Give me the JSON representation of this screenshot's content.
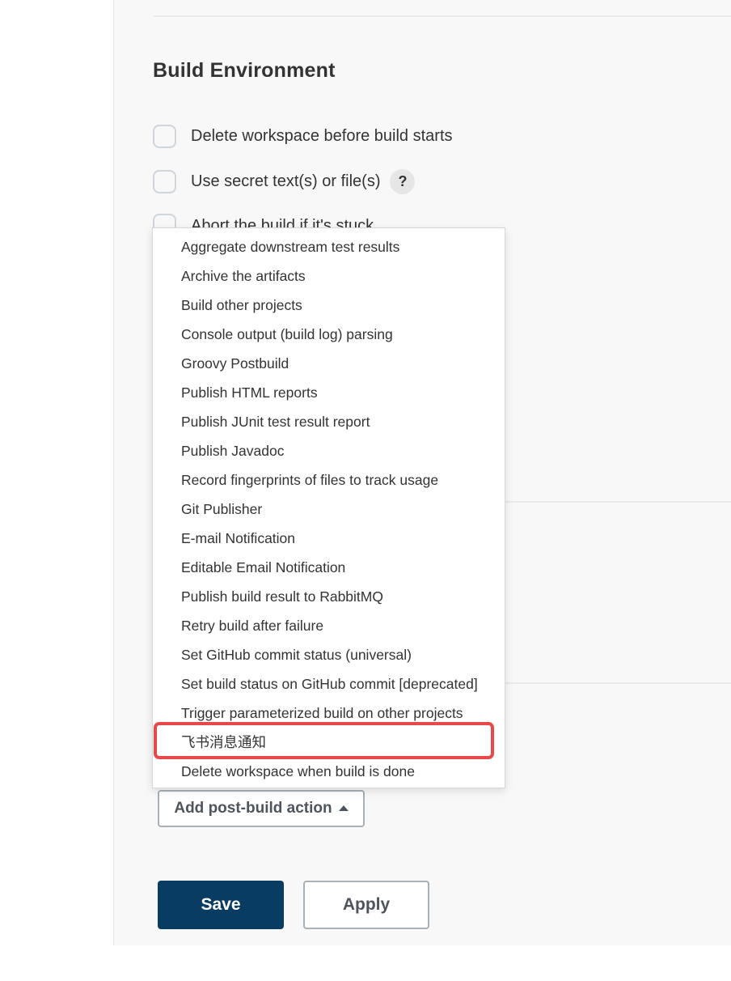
{
  "build_environment": {
    "title": "Build Environment",
    "options": [
      {
        "label": "Delete workspace before build starts",
        "checked": false
      },
      {
        "label": "Use secret text(s) or file(s)",
        "checked": false,
        "help": "?"
      },
      {
        "label": "Abort the build if it's stuck",
        "checked": false
      }
    ]
  },
  "post_build_menu": {
    "items": [
      "Aggregate downstream test results",
      "Archive the artifacts",
      "Build other projects",
      "Console output (build log) parsing",
      "Groovy Postbuild",
      "Publish HTML reports",
      "Publish JUnit test result report",
      "Publish Javadoc",
      "Record fingerprints of files to track usage",
      "Git Publisher",
      "E-mail Notification",
      "Editable Email Notification",
      "Publish build result to RabbitMQ",
      "Retry build after failure",
      "Set GitHub commit status (universal)",
      "Set build status on GitHub commit [deprecated]",
      "Trigger parameterized build on other projects",
      "飞书消息通知",
      "Delete workspace when build is done"
    ],
    "highlighted_item": "飞书消息通知",
    "highlight_color": "#e84848"
  },
  "add_post_build_action": {
    "label": "Add post-build action",
    "icon": "caret-up-icon"
  },
  "form_actions": {
    "save_label": "Save",
    "apply_label": "Apply",
    "save_color": "#093c62"
  }
}
